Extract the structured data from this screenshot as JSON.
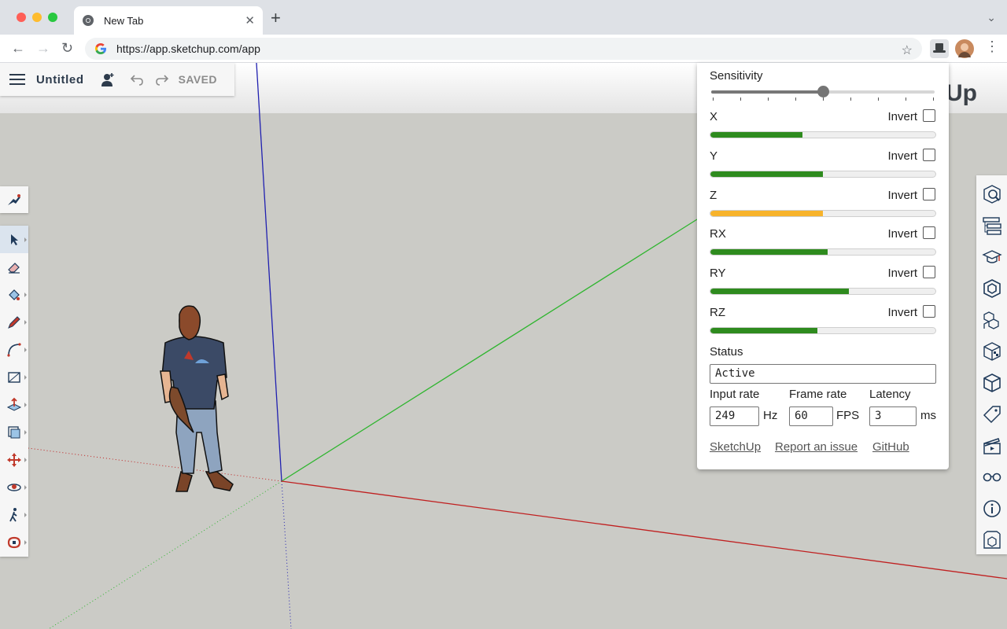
{
  "browser": {
    "tab_title": "New Tab",
    "url": "https://app.sketchup.com/app"
  },
  "file": {
    "title": "Untitled",
    "save_state": "SAVED"
  },
  "brand_text": "Up",
  "left_toolbar": {
    "tools": [
      "search",
      "select",
      "eraser",
      "paint-bucket",
      "line",
      "arc",
      "rectangle",
      "push-pull",
      "offset",
      "move",
      "orbit",
      "walk",
      "rotate"
    ]
  },
  "right_toolbar": {
    "panels": [
      "entity-info",
      "outliner",
      "instructor",
      "components",
      "materials",
      "styles",
      "solid-tools",
      "tags",
      "scenes",
      "display",
      "model-info",
      "3d-warehouse"
    ]
  },
  "panel": {
    "sensitivity_label": "Sensitivity",
    "sensitivity_value": 0.5,
    "invert_label": "Invert",
    "axes": [
      {
        "label": "X",
        "value": 0.41,
        "color": "#2e8b1e",
        "inverted": false
      },
      {
        "label": "Y",
        "value": 0.5,
        "color": "#2e8b1e",
        "inverted": false
      },
      {
        "label": "Z",
        "value": 0.5,
        "color": "#f7b32b",
        "inverted": false
      },
      {
        "label": "RX",
        "value": 0.52,
        "color": "#2e8b1e",
        "inverted": false
      },
      {
        "label": "RY",
        "value": 0.615,
        "color": "#2e8b1e",
        "inverted": false
      },
      {
        "label": "RZ",
        "value": 0.475,
        "color": "#2e8b1e",
        "inverted": false
      }
    ],
    "status_label": "Status",
    "status_value": "Active",
    "input_rate_label": "Input rate",
    "input_rate_value": "249",
    "input_rate_unit": "Hz",
    "frame_rate_label": "Frame rate",
    "frame_rate_value": "60",
    "frame_rate_unit": "FPS",
    "latency_label": "Latency",
    "latency_value": "3",
    "latency_unit": "ms",
    "links": [
      "SketchUp",
      "Report an issue",
      "GitHub"
    ]
  }
}
